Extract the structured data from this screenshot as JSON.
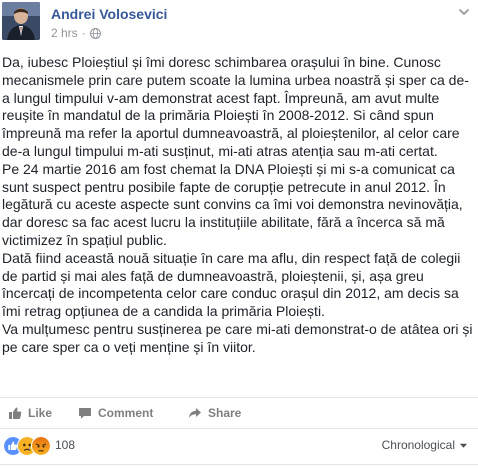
{
  "post": {
    "author": "Andrei Volosevici",
    "time": "2 hrs",
    "separator": "·",
    "icons": {
      "privacy": "globe-icon",
      "menu": "chevron-down-icon",
      "avatar": "profile-photo"
    },
    "paragraphs": [
      "Da, iubesc Ploieștiul și îmi doresc schimbarea orașului în bine. Cunosc mecanismele prin care putem scoate la lumina urbea noastră și sper ca de-a lungul timpului v-am demonstrat acest fapt. Împreună, am avut multe reușite în mandatul de la primăria Ploiești în 2008-2012. Si când spun împreună ma refer la aportul dumneavoastră, al ploieștenilor, al celor care de-a lungul timpului m-ati susținut, mi-ati atras atenția sau m-ati certat.",
      "Pe 24 martie 2016 am fost chemat la DNA Ploiești și mi s-a comunicat ca sunt suspect pentru posibile fapte de corupție petrecute in anul 2012. În legătură cu aceste aspecte sunt convins ca îmi voi demonstra nevinovăția, dar doresc sa fac acest lucru la instituțiile abilitate, fără a încerca să mă victimizez în spațiul public.",
      "Dată fiind această nouă situație în care ma aflu, din respect față de colegii de partid și mai ales față de dumneavoastră, ploieștenii, și, așa greu încercați de incompetenta celor care conduc orașul din 2012, am decis sa îmi retrag opțiunea de a candida la primăria Ploiești.",
      "Va mulțumesc pentru susținerea pe care mi-ati demonstrat-o de atâtea ori și pe care sper ca o veți menține și în viitor."
    ]
  },
  "actions": {
    "like": "Like",
    "comment": "Comment",
    "share": "Share"
  },
  "reactions": {
    "count": "108",
    "types": [
      "like",
      "sad",
      "angry"
    ],
    "colors": {
      "like": "#5890ff",
      "sad": "#f7b125",
      "angry": "#e9710f"
    }
  },
  "comments": {
    "sort_label": "Chronological"
  },
  "colors": {
    "author": "#365899",
    "meta": "#90949c",
    "text": "#1d2129",
    "action": "#7f7f7f"
  }
}
